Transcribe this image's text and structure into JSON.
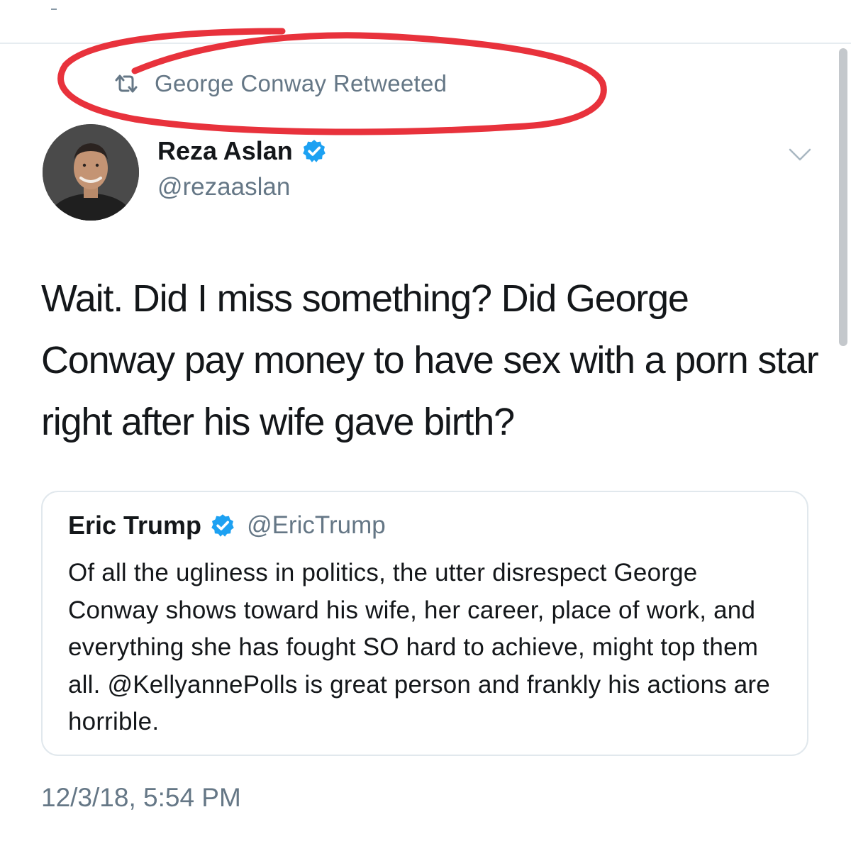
{
  "retweet": {
    "label": "George Conway Retweeted",
    "icon": "retweet-icon"
  },
  "tweet": {
    "author": {
      "name": "Reza Aslan",
      "handle": "@rezaaslan",
      "verified": true,
      "avatar": "profile-photo"
    },
    "text": "Wait. Did I miss something? Did George Conway pay money to have sex with a porn star right after his wife gave birth?",
    "timestamp": "12/3/18, 5:54 PM",
    "menu_icon": "chevron-down-icon"
  },
  "quoted_tweet": {
    "author": {
      "name": "Eric Trump",
      "handle": "@EricTrump",
      "verified": true
    },
    "text": "Of all the ugliness in politics, the utter disrespect George Conway shows toward his wife, her career, place of work, and everything she has fought SO hard to achieve, might top them all. @KellyannePolls is great person and frankly his actions are horrible."
  },
  "colors": {
    "text_primary": "#14171a",
    "text_secondary": "#657786",
    "verified_blue": "#1da1f2",
    "annotation_red": "#e8323c",
    "border": "#e1e8ed"
  }
}
